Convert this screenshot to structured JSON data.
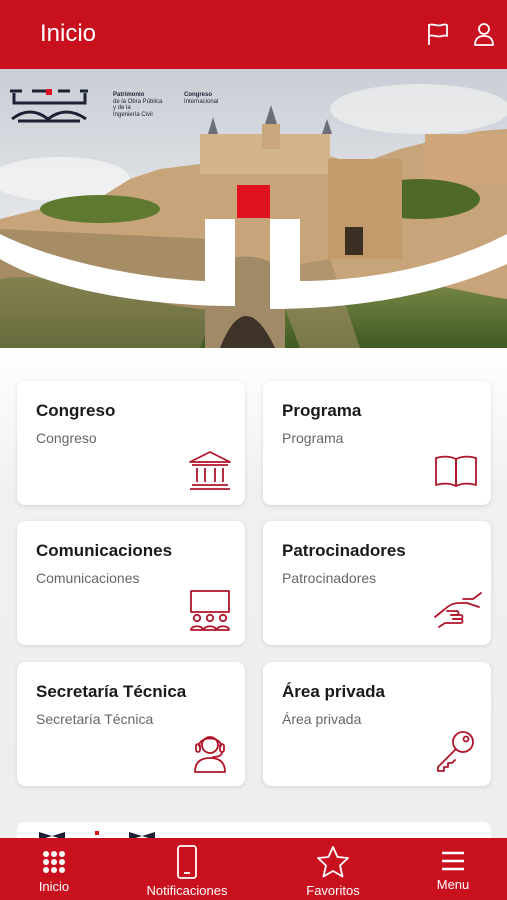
{
  "header": {
    "title": "Inicio",
    "flag_icon": "flag-icon",
    "user_icon": "user-icon"
  },
  "hero": {
    "logo_line1": "Patrimonio",
    "logo_line2": "de la Obra Pública",
    "logo_line3": "y de la",
    "logo_line4": "Ingeniería Civil",
    "congreso_title1": "Congreso",
    "congreso_title2": "Internacional",
    "accent_color": "#e0121f"
  },
  "cards": [
    {
      "title": "Congreso",
      "subtitle": "Congreso",
      "icon": "institution-icon"
    },
    {
      "title": "Programa",
      "subtitle": "Programa",
      "icon": "book-icon"
    },
    {
      "title": "Comunicaciones",
      "subtitle": "Comunicaciones",
      "icon": "presentation-icon"
    },
    {
      "title": "Patrocinadores",
      "subtitle": "Patrocinadores",
      "icon": "handshake-icon"
    },
    {
      "title": "Secretaría Técnica",
      "subtitle": "Secretaría Técnica",
      "icon": "headset-icon"
    },
    {
      "title": "Área privada",
      "subtitle": "Área privada",
      "icon": "key-icon"
    }
  ],
  "bottom_nav": [
    {
      "label": "Inicio",
      "icon": "grid-icon"
    },
    {
      "label": "Notificaciones",
      "icon": "phone-icon"
    },
    {
      "label": "Favoritos",
      "icon": "star-icon"
    },
    {
      "label": "Menu",
      "icon": "hamburger-icon"
    }
  ],
  "colors": {
    "brand": "#c8101f",
    "icon_stroke": "#b0142a"
  }
}
